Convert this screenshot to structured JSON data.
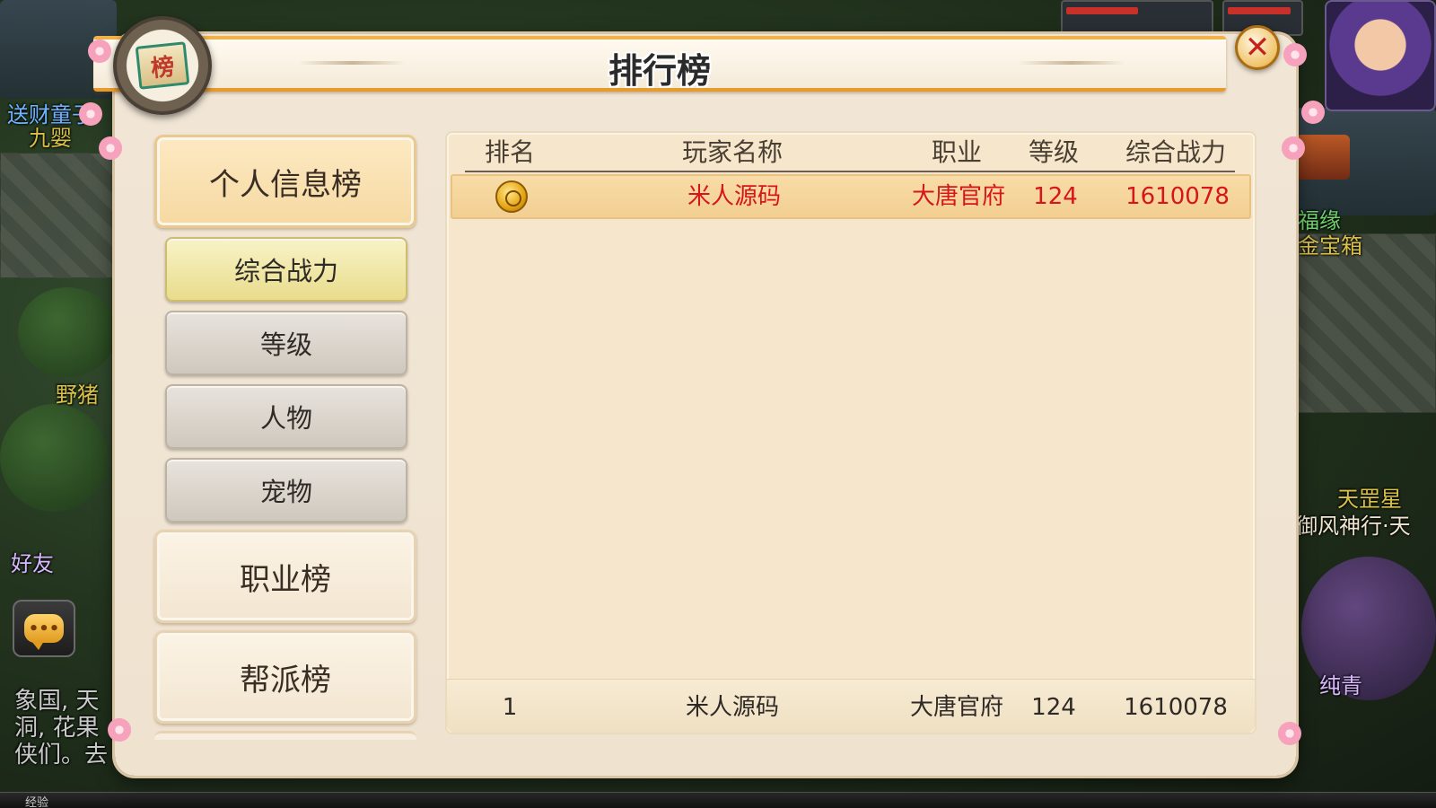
{
  "window": {
    "title": "排行榜",
    "emblem_char": "榜",
    "close_symbol": "✕"
  },
  "world": {
    "npc_label_1": "送财童子",
    "npc_label_2": "九婴",
    "npc_label_3": "野猪",
    "npc_label_4": "好友",
    "npc_label_5": "福缘",
    "npc_label_6": "金宝箱",
    "npc_label_7": "天罡星",
    "npc_label_8": "御风神行·天",
    "npc_label_9": "纯青",
    "chat_line_1": "象国, 天",
    "chat_line_2": "洞, 花果",
    "chat_line_3": "侠们。去",
    "xp_label": "经验",
    "chat_icon_glyph": "•••"
  },
  "sidebar": {
    "categories": [
      {
        "label": "个人信息榜",
        "active": true
      },
      {
        "label": "职业榜",
        "active": false
      },
      {
        "label": "帮派榜",
        "active": false
      }
    ],
    "sub_items": [
      {
        "label": "综合战力",
        "active": true
      },
      {
        "label": "等级",
        "active": false
      },
      {
        "label": "人物",
        "active": false
      },
      {
        "label": "宠物",
        "active": false
      }
    ]
  },
  "table": {
    "columns": [
      "排名",
      "玩家名称",
      "职业",
      "等级",
      "综合战力"
    ],
    "rows": [
      {
        "rank": 1,
        "rank_icon": "gold-medal-icon",
        "name": "米人源码",
        "job": "大唐官府",
        "level": "124",
        "power": "1610078"
      }
    ],
    "self_row": {
      "rank": "1",
      "name": "米人源码",
      "job": "大唐官府",
      "level": "124",
      "power": "1610078"
    }
  },
  "colors": {
    "panel_bg": "#f1e6d6",
    "title_border": "#e59b2f",
    "row_highlight": "#f2cf92",
    "highlight_text": "#d6161b",
    "sub_item_active": "#e9dc8c",
    "close_x": "#c4221a"
  }
}
